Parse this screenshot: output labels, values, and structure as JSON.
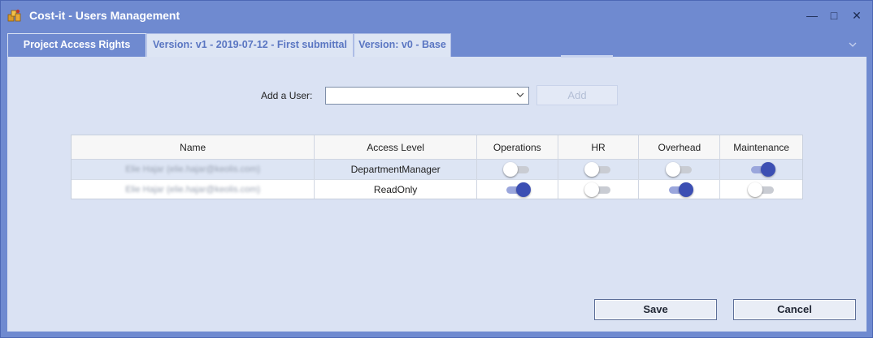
{
  "window": {
    "title": "Cost-it - Users Management",
    "controls": {
      "minimize": "—",
      "maximize": "□",
      "close": "✕"
    }
  },
  "tabs": [
    {
      "label": "Project Access Rights",
      "active": true
    },
    {
      "label": "Version: v1 - 2019-07-12 - First submittal",
      "active": false
    },
    {
      "label": "Version: v0 - Base",
      "active": false
    }
  ],
  "add_user": {
    "label": "Add a User:",
    "selected_value": "",
    "button_label": "Add"
  },
  "table": {
    "columns": [
      "Name",
      "Access Level",
      "Operations",
      "HR",
      "Overhead",
      "Maintenance"
    ],
    "rows": [
      {
        "name": "Elie Hajar (elie.hajar@keolis.com)",
        "access_level": "DepartmentManager",
        "operations": false,
        "hr": false,
        "overhead": false,
        "maintenance": true,
        "selected": true
      },
      {
        "name": "Elie Hajar (elie.hajar@keolis.com)",
        "access_level": "ReadOnly",
        "operations": true,
        "hr": false,
        "overhead": true,
        "maintenance": false,
        "selected": false
      }
    ]
  },
  "footer": {
    "save_label": "Save",
    "cancel_label": "Cancel"
  },
  "colors": {
    "accent": "#3c4fb3",
    "window_chrome": "#6f8ad0",
    "panel": "#dae2f3"
  },
  "icons": {
    "app": "cost-it-app-icon",
    "dropdown": "chevron-down-icon",
    "tab_overflow": "chevron-down-icon"
  }
}
